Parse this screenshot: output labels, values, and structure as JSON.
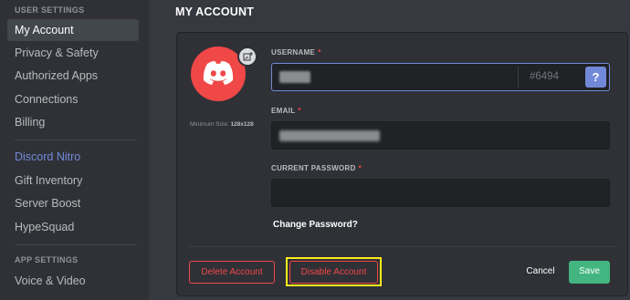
{
  "sidebar": {
    "section_user_settings": "USER SETTINGS",
    "items": [
      {
        "label": "My Account"
      },
      {
        "label": "Privacy & Safety"
      },
      {
        "label": "Authorized Apps"
      },
      {
        "label": "Connections"
      },
      {
        "label": "Billing"
      }
    ],
    "nitro_items": [
      {
        "label": "Discord Nitro"
      },
      {
        "label": "Gift Inventory"
      },
      {
        "label": "Server Boost"
      },
      {
        "label": "HypeSquad"
      }
    ],
    "section_app_settings": "APP SETTINGS",
    "app_items": [
      {
        "label": "Voice & Video"
      }
    ]
  },
  "page_title": "MY ACCOUNT",
  "avatar": {
    "min_size_label": "Minimum Size:",
    "min_size_value": "128x128",
    "color": "#f04747"
  },
  "fields": {
    "username_label": "USERNAME",
    "discriminator": "#6494",
    "help_label": "?",
    "email_label": "EMAIL",
    "password_label": "CURRENT PASSWORD",
    "required_marker": "*"
  },
  "change_password_label": "Change Password?",
  "buttons": {
    "delete_label": "Delete Account",
    "disable_label": "Disable Account",
    "cancel_label": "Cancel",
    "save_label": "Save"
  },
  "colors": {
    "accent": "#7289da",
    "danger": "#f04747",
    "success": "#43b581",
    "highlight": "#faeb1a"
  }
}
